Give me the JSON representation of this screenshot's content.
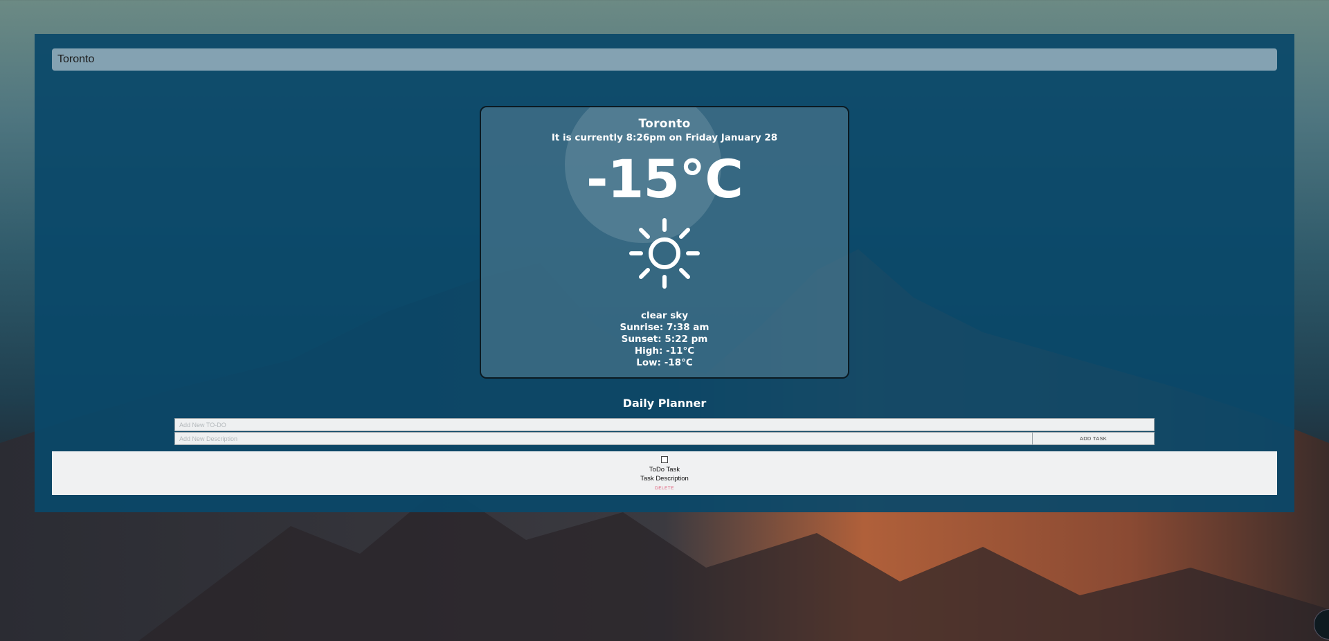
{
  "search": {
    "value": "Toronto"
  },
  "weather": {
    "city": "Toronto",
    "current_time_text": "It is currently 8:26pm on Friday January 28",
    "temperature": "-15°C",
    "icon": "sun-icon",
    "description": "clear sky",
    "sunrise": "Sunrise: 7:38 am",
    "sunset": "Sunset: 5:22 pm",
    "high": "High: -11°C",
    "low": "Low: -18°C"
  },
  "planner": {
    "title": "Daily Planner",
    "todo_placeholder": "Add New TO-DO",
    "description_placeholder": "Add New Description",
    "add_button_label": "ADD TASK",
    "tasks": [
      {
        "title": "ToDo Task",
        "description": "Task Description",
        "delete_label": "DELETE",
        "checked": false
      }
    ]
  },
  "colors": {
    "panel": "#0a4869",
    "delete": "#e0607a"
  }
}
